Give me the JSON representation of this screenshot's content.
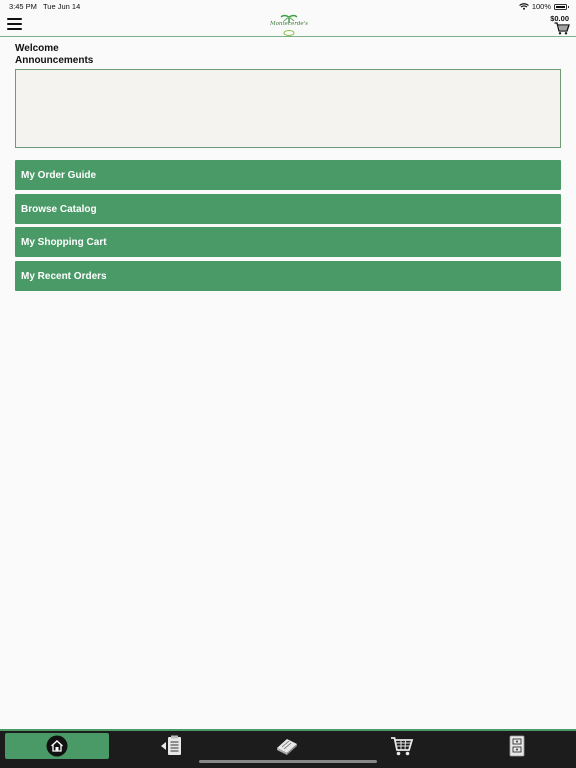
{
  "status_bar": {
    "time": "3:45 PM",
    "date": "Tue Jun 14",
    "battery": "100%"
  },
  "header": {
    "logo_text": "Montecerde's",
    "cart_total": "$0.00"
  },
  "main": {
    "welcome": "Welcome",
    "announcements_label": "Announcements",
    "buttons": [
      {
        "label": "My Order Guide"
      },
      {
        "label": "Browse Catalog"
      },
      {
        "label": "My Shopping Cart"
      },
      {
        "label": "My Recent Orders"
      }
    ]
  },
  "tabbar": {
    "tabs": [
      {
        "icon": "home-icon",
        "active": true
      },
      {
        "icon": "order-guide-icon",
        "active": false
      },
      {
        "icon": "catalog-icon",
        "active": false
      },
      {
        "icon": "cart-icon",
        "active": false
      },
      {
        "icon": "account-icon",
        "active": false
      }
    ]
  },
  "colors": {
    "accent": "#4a9a68",
    "tabbar_bg": "#1c1c1c"
  }
}
